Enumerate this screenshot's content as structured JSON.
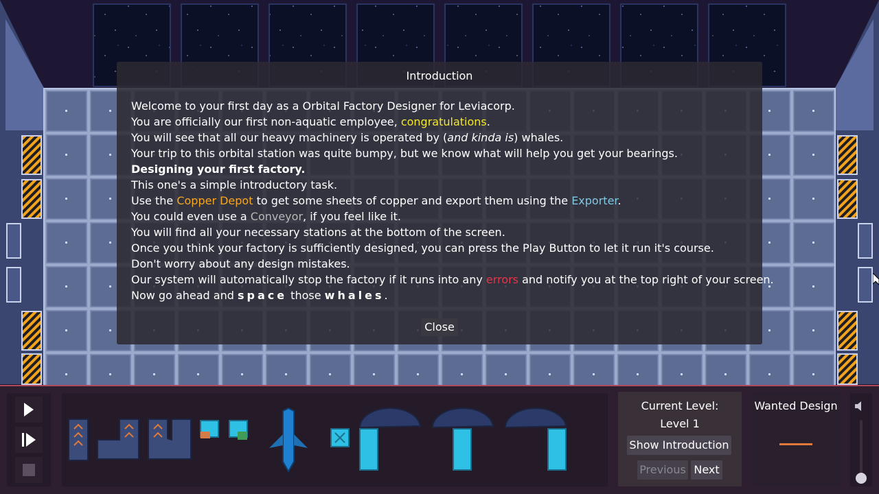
{
  "dialog": {
    "title": "Introduction",
    "close_label": "Close",
    "lines": {
      "l1": "Welcome to your first day as a Orbital Factory Designer for Leviacorp.",
      "l2a": "You are officially our first non-aquatic employee, ",
      "l2b": "congratulations",
      "l2c": ".",
      "l3a": "You will see that all our heavy machinery is operated by (",
      "l3b": "and kinda is",
      "l3c": ") whales.",
      "l4": "Your trip to this orbital station was quite bumpy, but we know what will help you get your bearings.",
      "l5": "Designing your first factory.",
      "l6": "This one's a simple introductory task.",
      "l7a": "Use the ",
      "l7b": "Copper Depot",
      "l7c": " to get some sheets of copper and export them using the ",
      "l7d": "Exporter",
      "l7e": ".",
      "l8a": "You could even use a ",
      "l8b": "Conveyor",
      "l8c": ", if you feel like it.",
      "l9": "You will find all your necessary stations at the bottom of the screen.",
      "l10": "Once you think your factory is sufficiently designed, you can press the Play Button to let it run it's course.",
      "l11": "Don't worry about any design mistakes.",
      "l12a": "Our system will automatically stop the factory if it runs into any ",
      "l12b": "errors",
      "l12c": " and notify you at the top right of your screen.",
      "l13a": "Now go ahead and ",
      "l13b": "space",
      "l13c": " those ",
      "l13d": "whales",
      "l13e": "."
    }
  },
  "controls": {
    "play_icon": "play-icon",
    "step_icon": "step-forward-icon",
    "stop_icon": "stop-icon"
  },
  "level": {
    "label": "Current Level:",
    "name": "Level 1",
    "show_intro_label": "Show Introduction",
    "previous_label": "Previous",
    "next_label": "Next"
  },
  "wanted": {
    "label": "Wanted Design",
    "accent": "#e07a3a"
  },
  "volume": {
    "icon": "speaker-icon",
    "level": 0.08
  },
  "colors": {
    "keyword_yellow": "#f2e62c",
    "keyword_orange": "#f5a623",
    "keyword_blue": "#7ec8e3",
    "keyword_gray": "#b7b7b7",
    "keyword_red": "#e5354a",
    "bar_border": "#b04a5e"
  }
}
